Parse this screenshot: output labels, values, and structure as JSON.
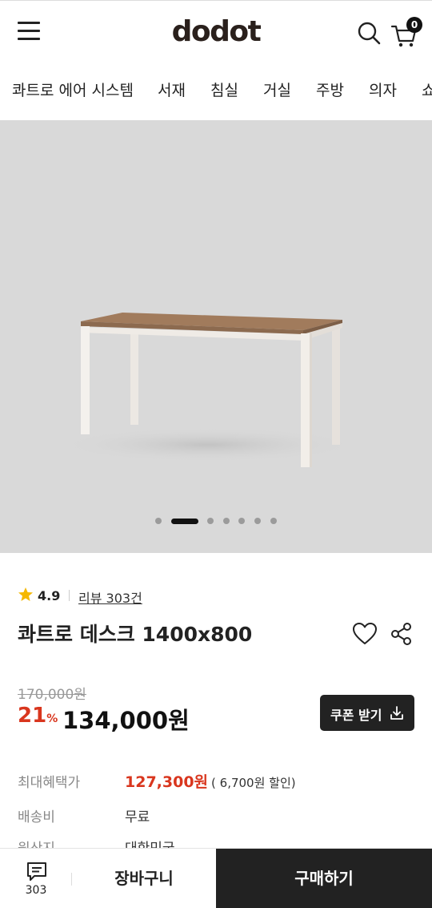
{
  "header": {
    "logo": "dodot",
    "cart_count": "0"
  },
  "nav": {
    "items": [
      "콰트로 에어 시스템",
      "서재",
      "침실",
      "거실",
      "주방",
      "의자",
      "쇼"
    ]
  },
  "gallery": {
    "total_slides": 7,
    "active_index": 1
  },
  "product": {
    "rating": "4.9",
    "review_link": "리뷰 303건",
    "title": "콰트로 데스크 1400x800",
    "original_price": "170,000원",
    "discount_number": "21",
    "discount_unit": "%",
    "sale_price": "134,000원",
    "coupon_label": "쿠폰 받기"
  },
  "info": {
    "benefit_label": "최대혜택가",
    "benefit_price": "127,300원",
    "benefit_note": "( 6,700원 할인)",
    "shipping_label": "배송비",
    "shipping_value": "무료",
    "origin_label": "원산지",
    "origin_value": "대한민국"
  },
  "bottom_bar": {
    "chat_count": "303",
    "cart_button": "장바구니",
    "buy_button": "구매하기"
  },
  "colors": {
    "accent_red": "#d9361e",
    "dark": "#222222",
    "hero_bg": "#d9d9d9"
  }
}
